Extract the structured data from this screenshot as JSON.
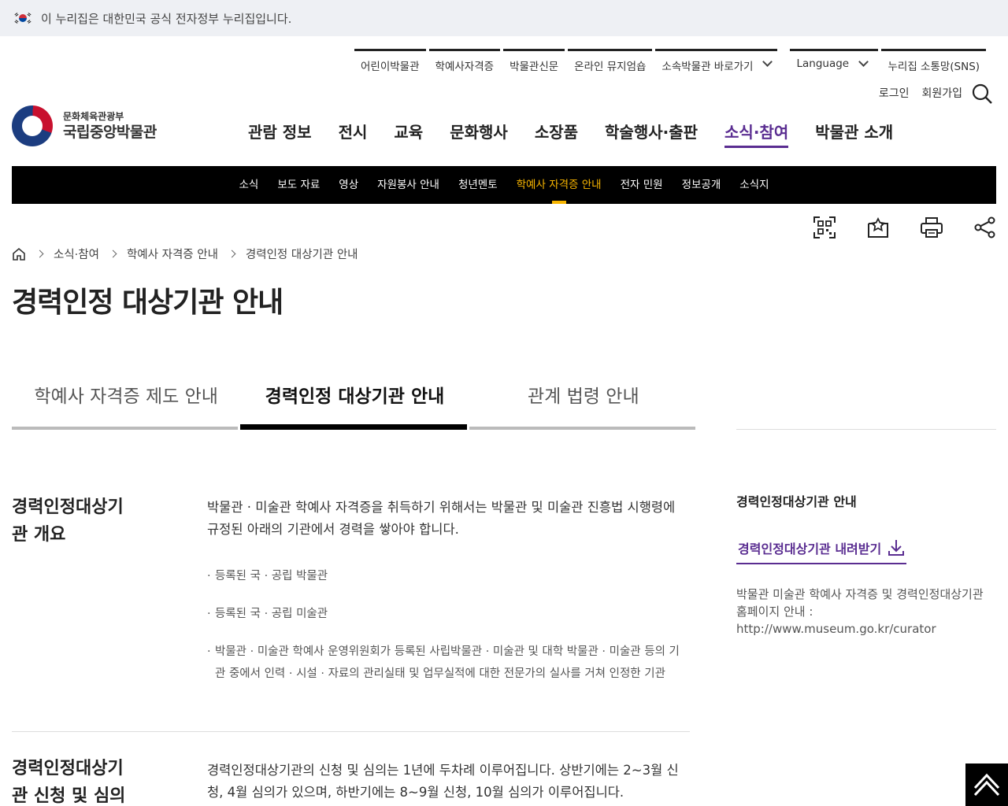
{
  "gov_banner": {
    "text": "이 누리집은 대한민국 공식 전자정부 누리집입니다."
  },
  "utility": {
    "items": [
      "어린이박물관",
      "학예사자격증",
      "박물관신문",
      "온라인 뮤지엄숍"
    ],
    "affiliated": "소속박물관 바로가기",
    "language": "Language",
    "sns": "누리집 소통망(SNS)"
  },
  "member": {
    "login": "로그인",
    "join": "회원가입"
  },
  "logo": {
    "sub": "문화체육관광부",
    "main": "국립중앙박물관"
  },
  "gnb": [
    "관람 정보",
    "전시",
    "교육",
    "문화행사",
    "소장품",
    "학술행사·출판",
    "소식·참여",
    "박물관 소개"
  ],
  "gnb_active_index": 6,
  "subnav": [
    "소식",
    "보도 자료",
    "영상",
    "자원봉사 안내",
    "청년멘토",
    "학예사 자격증 안내",
    "전자 민원",
    "정보공개",
    "소식지"
  ],
  "subnav_active_index": 5,
  "tools": [
    "qr-code-icon",
    "bookmark-icon",
    "print-icon",
    "share-icon"
  ],
  "breadcrumb": {
    "items": [
      "소식·참여",
      "학예사 자격증 안내",
      "경력인정 대상기관 안내"
    ]
  },
  "page_title": "경력인정 대상기관 안내",
  "tabs": [
    "학예사 자격증 제도 안내",
    "경력인정 대상기관 안내",
    "관계 법령 안내"
  ],
  "tabs_active_index": 1,
  "sections": [
    {
      "title_line1": "경력인정대상기",
      "title_line2": "관 개요",
      "body": "박물관 · 미술관 학예사 자격증을 취득하기 위해서는 박물관 및 미술관 진흥법 시행령에 규정된 아래의 기관에서 경력을 쌓아야 합니다.",
      "bullets": [
        "등록된 국 · 공립 박물관",
        "등록된 국 · 공립 미술관",
        "박물관 · 미술관 학예사 운영위원회가 등록된 사립박물관 · 미술관 및 대학 박물관 · 미술관 등의 기관 중에서 인력 · 시설 · 자료의 관리실태 및 업무실적에 대한 전문가의 실사를 거쳐 인정한 기관"
      ]
    },
    {
      "title_line1": "경력인정대상기",
      "title_line2": "관 신청 및 심의",
      "body": "경력인정대상기관의 신청 및 심의는 1년에 두차례 이루어집니다. 상반기에는 2~3월 신청, 4월 심의가 있으며, 하반기에는 8~9월 신청, 10월 심의가 이루어집니다."
    }
  ],
  "side": {
    "title": "경력인정대상기관 안내",
    "download": "경력인정대상기관 내려받기",
    "desc_line1": "박물관 미술관 학예사 자격증 및 경력인정대상기관",
    "desc_line2": "홈페이지 안내 :",
    "desc_url": "http://www.museum.go.kr/curator"
  },
  "colors": {
    "accent": "#5a2d91",
    "subnav_active": "#f7b500",
    "subnav_bg": "#000000"
  }
}
